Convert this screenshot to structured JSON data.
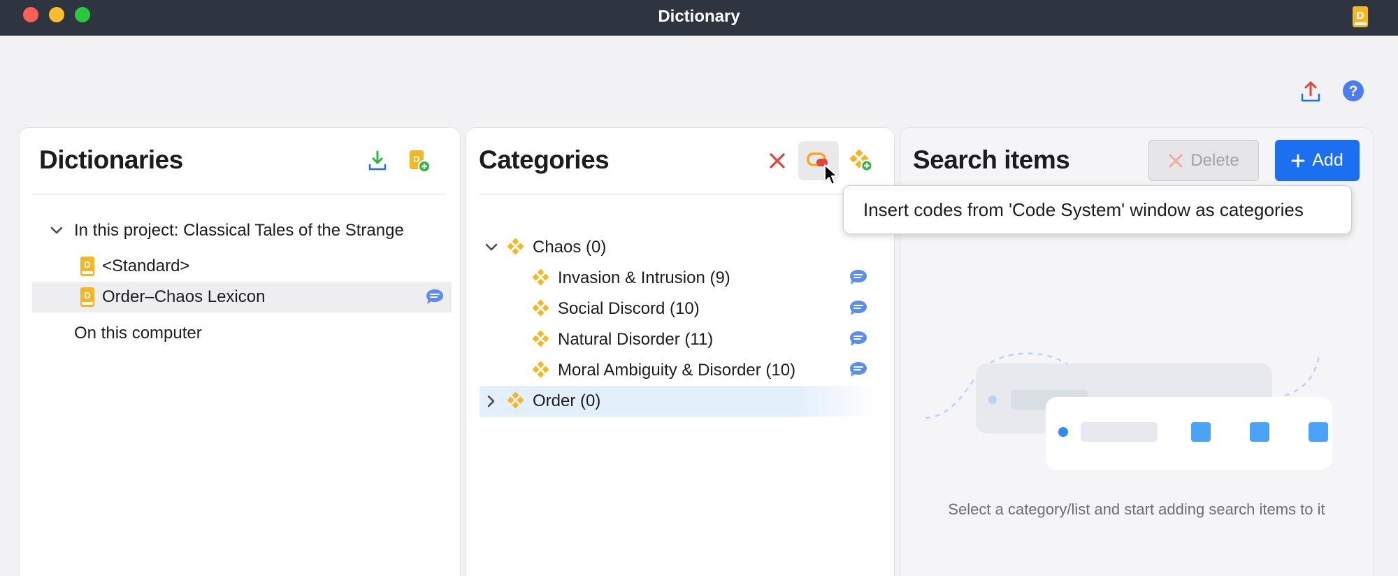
{
  "window": {
    "title": "Dictionary"
  },
  "colors": {
    "accent": "#1d6ff2",
    "titlebar": "#2f3441",
    "dictionary_icon": "#f4b622",
    "category_icon": "#f4b622",
    "comment_icon": "#5b8def",
    "delete_red": "#e0453c"
  },
  "toolbar": {
    "export_icon": "export-icon",
    "help_icon": "help-icon"
  },
  "dictionaries": {
    "title": "Dictionaries",
    "groups": [
      {
        "label": "In this project: Classical Tales of the Strange",
        "expanded": true
      },
      {
        "label": "On this computer"
      }
    ],
    "items": [
      {
        "label": "<Standard>"
      },
      {
        "label": "Order–Chaos Lexicon",
        "selected": true,
        "has_comment": true
      }
    ]
  },
  "categories": {
    "title": "Categories",
    "tree": [
      {
        "label": "Chaos (0)",
        "expanded": true
      },
      {
        "label": "Invasion & Intrusion (9)",
        "has_comment": true
      },
      {
        "label": "Social Discord (10)",
        "has_comment": true
      },
      {
        "label": "Natural Disorder (11)",
        "has_comment": true
      },
      {
        "label": "Moral Ambiguity & Disorder (10)",
        "has_comment": true
      },
      {
        "label": "Order (0)",
        "expanded": false,
        "highlighted": true
      }
    ]
  },
  "search_items": {
    "title": "Search items",
    "delete_label": "Delete",
    "add_label": "Add",
    "empty_message": "Select a category/list and start adding search items to it"
  },
  "tooltip": {
    "text": "Insert codes from 'Code System' window as categories"
  }
}
